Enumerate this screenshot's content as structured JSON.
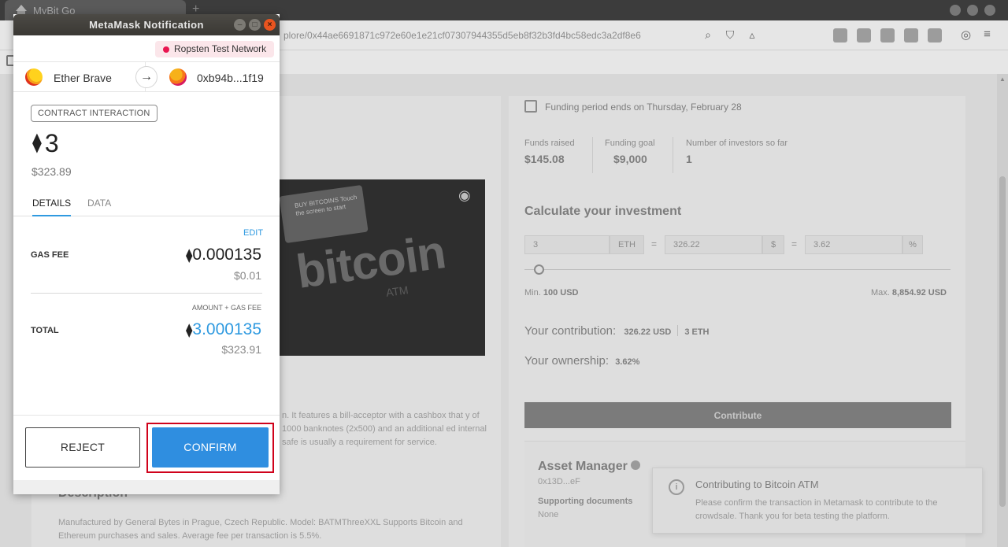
{
  "browser": {
    "tab_title": "MyBit Go",
    "new_tab_glyph": "+",
    "url_text": "plore/0x44ae6691871c972e60e1e21cf07307944355d5eb8f32b3fd4bc58edc3a2df8e6",
    "icons": [
      "zoom-icon",
      "shield-icon",
      "warning-icon",
      "ext-icons",
      "account-icon",
      "menu-icon"
    ]
  },
  "page": {
    "funding_period": "Funding period ends on Thursday, February 28",
    "stats": [
      {
        "label": "Funds raised",
        "value": "$145.08"
      },
      {
        "label": "Funding goal",
        "value": "$9,000"
      },
      {
        "label": "Number of investors so far",
        "value": "1"
      }
    ],
    "calc_title": "Calculate your investment",
    "eth_amount": "3",
    "eth_unit": "ETH",
    "usd_amount": "326.22",
    "usd_unit": "$",
    "pct_amount": "3.62",
    "pct_unit": "%",
    "eq": "=",
    "min_label": "Min.",
    "min_value": "100 USD",
    "max_label": "Max.",
    "max_value": "8,854.92 USD",
    "contribution_label": "Your contribution:",
    "contribution_usd": "326.22 USD",
    "contribution_eth": "3 ETH",
    "ownership_label": "Your ownership:",
    "ownership_value": "3.62%",
    "contribute_button": "Contribute",
    "asset_manager_title": "Asset Manager",
    "asset_manager_addr": "0x13D...eF",
    "supporting_docs_label": "Supporting documents",
    "supporting_docs_value": "None",
    "description_partial": "n. It features a bill-acceptor with a cashbox that y of 1000 banknotes (2x500) and an additional ed internal safe is usually a requirement for service.",
    "description_title": "Description",
    "description_body": "Manufactured by General Bytes in Prague, Czech Republic. Model: BATMThreeXXL Supports Bitcoin and Ethereum purchases and sales. Average fee per transaction is 5.5%.",
    "image_screen_text": "BUY BITCOINS Touch the screen to start",
    "image_word": "bitcoin",
    "image_sub": "ATM"
  },
  "toast": {
    "icon": "i",
    "title": "Contributing to Bitcoin ATM",
    "body": "Please confirm the transaction in Metamask to contribute to the crowdsale. Thank you for beta testing the platform."
  },
  "metamask": {
    "window_title": "MetaMask Notification",
    "network": "Ropsten Test Network",
    "from_account": "Ether Brave",
    "to_account": "0xb94b...1f19",
    "arrow": "→",
    "badge": "CONTRACT INTERACTION",
    "eth_symbol": "⧫",
    "amount": "3",
    "amount_fiat": "$323.89",
    "tabs": [
      "DETAILS",
      "DATA"
    ],
    "edit": "EDIT",
    "gas_fee_label": "GAS FEE",
    "gas_fee_value": "0.000135",
    "gas_fee_fiat": "$0.01",
    "amount_gas_label": "AMOUNT + GAS FEE",
    "total_label": "TOTAL",
    "total_value": "3.000135",
    "total_fiat": "$323.91",
    "reject_label": "REJECT",
    "confirm_label": "CONFIRM",
    "colors": {
      "accent": "#2f8ee0",
      "network_dot": "#e91550",
      "highlight": "#d0021b"
    }
  }
}
